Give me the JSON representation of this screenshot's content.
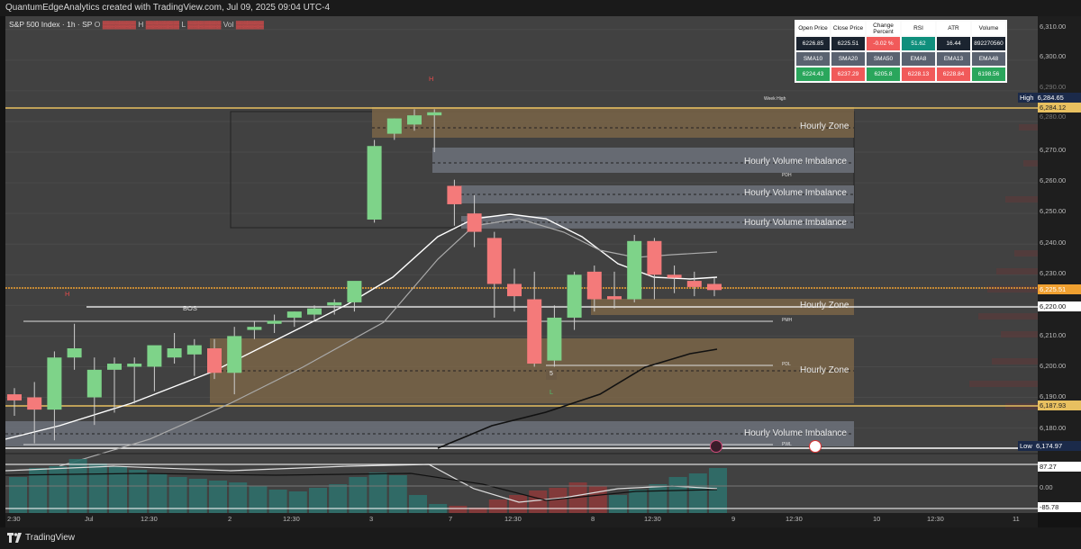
{
  "header": {
    "title": "QuantumEdgeAnalytics created with TradingView.com, Jul 09, 2025 09:04 UTC-4"
  },
  "legend": {
    "symbol": "S&P 500 Index · 1h · SP",
    "o": "O",
    "h": "H",
    "l": "L",
    "vol": "Vol"
  },
  "info_table": {
    "headers1": [
      "Open Price",
      "Close Price",
      "Change Percent",
      "RSI",
      "ATR",
      "Volume"
    ],
    "values1": [
      "6226.85",
      "6225.51",
      "-0.02 %",
      "51.62",
      "16.44",
      "892270560"
    ],
    "headers2": [
      "SMA10",
      "SMA20",
      "SMA50",
      "EMA8",
      "EMA13",
      "EMA48"
    ],
    "values2": [
      "6224.43",
      "6237.29",
      "6205.8",
      "6228.13",
      "6228.84",
      "6198.56"
    ]
  },
  "price_axis": {
    "ticks": [
      "6,310.00",
      "6,300.00",
      "6,290.00",
      "6,280.00",
      "6,270.00",
      "6,260.00",
      "6,250.00",
      "6,240.00",
      "6,230.00",
      "6,210.00",
      "6,200.00",
      "6,190.00",
      "6,180.00"
    ],
    "high_label": "High",
    "high_value": "6,284.65",
    "low_label": "Low",
    "low_value": "6,174.97",
    "badges": [
      "6,284.12",
      "6,225.51",
      "6,220.00",
      "6,187.93"
    ],
    "osc_badges": [
      "87.27",
      "0.00",
      "-85.78"
    ]
  },
  "time_axis": {
    "labels": [
      "2:30",
      "Jul",
      "12:30",
      "2",
      "12:30",
      "3",
      "7",
      "12:30",
      "8",
      "12:30",
      "9",
      "12:30",
      "10",
      "12:30",
      "11"
    ]
  },
  "zones": {
    "hourly_zone": "Hourly Zone",
    "hourly_volume_imbalance": "Hourly Volume Imbalance",
    "bos": "BOS",
    "pmh": "PMH",
    "pdl": "PDL",
    "pwl": "PWL",
    "week_high": "Week High",
    "pdh": "PDH",
    "h_mark": "H",
    "l_mark": "L",
    "five": "5"
  },
  "chart_data": {
    "type": "candlestick",
    "candles": [
      {
        "o": 6191,
        "h": 6193,
        "l": 6184,
        "c": 6189
      },
      {
        "o": 6190,
        "h": 6195,
        "l": 6175,
        "c": 6186
      },
      {
        "o": 6186,
        "h": 6205,
        "l": 6176,
        "c": 6203
      },
      {
        "o": 6203,
        "h": 6214,
        "l": 6199,
        "c": 6206
      },
      {
        "o": 6190,
        "h": 6203,
        "l": 6181,
        "c": 6199
      },
      {
        "o": 6199,
        "h": 6203,
        "l": 6185,
        "c": 6201
      },
      {
        "o": 6200,
        "h": 6203,
        "l": 6188,
        "c": 6201
      },
      {
        "o": 6200,
        "h": 6206,
        "l": 6192,
        "c": 6207
      },
      {
        "o": 6203,
        "h": 6211,
        "l": 6201,
        "c": 6206
      },
      {
        "o": 6204,
        "h": 6209,
        "l": 6197,
        "c": 6207
      },
      {
        "o": 6206,
        "h": 6209,
        "l": 6196,
        "c": 6198
      },
      {
        "o": 6198,
        "h": 6213,
        "l": 6191,
        "c": 6210
      },
      {
        "o": 6212,
        "h": 6215,
        "l": 6209,
        "c": 6213
      },
      {
        "o": 6214,
        "h": 6217,
        "l": 6211,
        "c": 6215
      },
      {
        "o": 6216,
        "h": 6218,
        "l": 6213,
        "c": 6218
      },
      {
        "o": 6217,
        "h": 6220,
        "l": 6215,
        "c": 6219
      },
      {
        "o": 6220,
        "h": 6222,
        "l": 6217,
        "c": 6221
      },
      {
        "o": 6221,
        "h": 6226,
        "l": 6218,
        "c": 6228
      },
      {
        "o": 6248,
        "h": 6274,
        "l": 6247,
        "c": 6272
      },
      {
        "o": 6276,
        "h": 6281,
        "l": 6274,
        "c": 6281
      },
      {
        "o": 6279,
        "h": 6284,
        "l": 6277,
        "c": 6282
      },
      {
        "o": 6282,
        "h": 6284,
        "l": 6270,
        "c": 6283
      },
      {
        "o": 6259,
        "h": 6261,
        "l": 6246,
        "c": 6253
      },
      {
        "o": 6250,
        "h": 6256,
        "l": 6239,
        "c": 6244
      },
      {
        "o": 6242,
        "h": 6244,
        "l": 6216,
        "c": 6227
      },
      {
        "o": 6227,
        "h": 6232,
        "l": 6218,
        "c": 6223
      },
      {
        "o": 6222,
        "h": 6231,
        "l": 6200,
        "c": 6201
      },
      {
        "o": 6202,
        "h": 6220,
        "l": 6200,
        "c": 6216
      },
      {
        "o": 6216,
        "h": 6231,
        "l": 6212,
        "c": 6230
      },
      {
        "o": 6231,
        "h": 6233,
        "l": 6218,
        "c": 6222
      },
      {
        "o": 6223,
        "h": 6231,
        "l": 6219,
        "c": 6222
      },
      {
        "o": 6222,
        "h": 6243,
        "l": 6221,
        "c": 6241
      },
      {
        "o": 6241,
        "h": 6242,
        "l": 6222,
        "c": 6230
      },
      {
        "o": 6230,
        "h": 6233,
        "l": 6224,
        "c": 6229
      },
      {
        "o": 6228,
        "h": 6231,
        "l": 6223,
        "c": 6226
      },
      {
        "o": 6227,
        "h": 6229,
        "l": 6223,
        "c": 6225
      }
    ],
    "ylim": [
      6174,
      6312
    ]
  },
  "colors": {
    "up": "#7ed389",
    "down": "#f47a7a",
    "zone": "#7a6548",
    "imbalance": "#6a6f78",
    "orange": "#f0a030",
    "gold": "#e8c060"
  }
}
